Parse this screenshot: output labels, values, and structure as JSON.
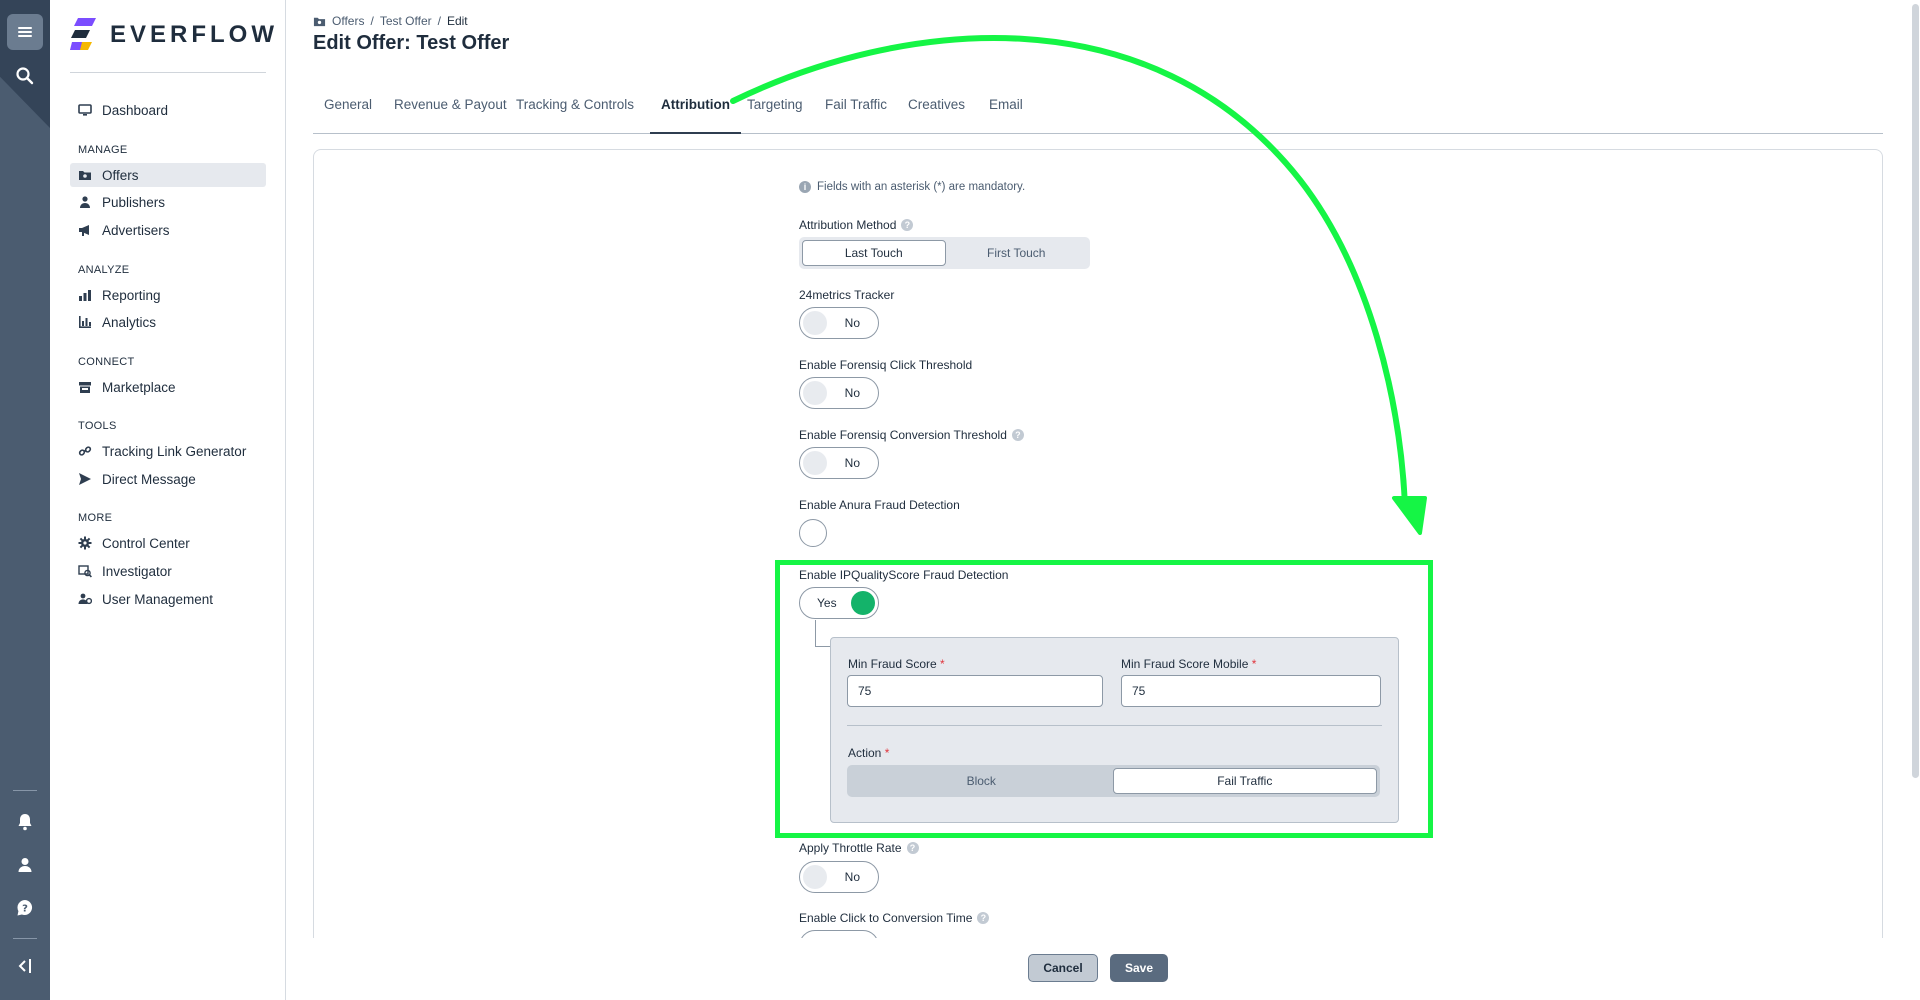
{
  "app": {
    "brand": "EVERFLOW",
    "colors": {
      "rail": "#4b5c70",
      "accent_green": "#14b36a",
      "annotation": "#15f545",
      "required": "#e0353d"
    }
  },
  "rail": {
    "icons": [
      "hamburger-menu-icon",
      "search-icon",
      "bell-icon",
      "user-icon",
      "help-icon",
      "collapse-sidebar-icon"
    ]
  },
  "sidebar": {
    "dashboard": "Dashboard",
    "sections": {
      "manage": "MANAGE",
      "analyze": "ANALYZE",
      "connect": "CONNECT",
      "tools": "TOOLS",
      "more": "MORE"
    },
    "items": {
      "offers": "Offers",
      "publishers": "Publishers",
      "advertisers": "Advertisers",
      "reporting": "Reporting",
      "analytics": "Analytics",
      "marketplace": "Marketplace",
      "tracking_link_generator": "Tracking Link Generator",
      "direct_message": "Direct Message",
      "control_center": "Control Center",
      "investigator": "Investigator",
      "user_management": "User Management"
    },
    "active_item": "Offers"
  },
  "breadcrumb": {
    "offers": "Offers",
    "sep": "/",
    "test_offer": "Test Offer",
    "edit": "Edit"
  },
  "page_title": "Edit Offer: Test Offer",
  "tabs": {
    "general": "General",
    "revenue_payout": "Revenue & Payout",
    "tracking_controls": "Tracking & Controls",
    "attribution": "Attribution",
    "targeting": "Targeting",
    "fail_traffic": "Fail Traffic",
    "creatives": "Creatives",
    "email": "Email",
    "active": "Attribution"
  },
  "form": {
    "info": "Fields with an asterisk (*) are mandatory.",
    "attribution_method": {
      "label": "Attribution Method",
      "options": [
        "Last Touch",
        "First Touch"
      ],
      "selected": "Last Touch"
    },
    "metrics_tracker": {
      "label": "24metrics Tracker",
      "value": "No"
    },
    "forensiq_click": {
      "label": "Enable Forensiq Click Threshold",
      "value": "No"
    },
    "forensiq_conversion": {
      "label": "Enable Forensiq Conversion Threshold",
      "value": "No"
    },
    "anura": {
      "label": "Enable Anura Fraud Detection"
    },
    "ipqs": {
      "label": "Enable IPQualityScore Fraud Detection",
      "value": "Yes",
      "min_fraud_score": {
        "label": "Min Fraud Score",
        "required": "*",
        "value": "75"
      },
      "min_fraud_score_mobile": {
        "label": "Min Fraud Score Mobile",
        "required": "*",
        "value": "75"
      },
      "action": {
        "label": "Action",
        "required": "*",
        "options": [
          "Block",
          "Fail Traffic"
        ],
        "selected": "Fail Traffic"
      }
    },
    "throttle": {
      "label": "Apply Throttle Rate",
      "value": "No"
    },
    "click_to_conversion": {
      "label": "Enable Click to Conversion Time"
    }
  },
  "footer": {
    "cancel": "Cancel",
    "save": "Save"
  }
}
